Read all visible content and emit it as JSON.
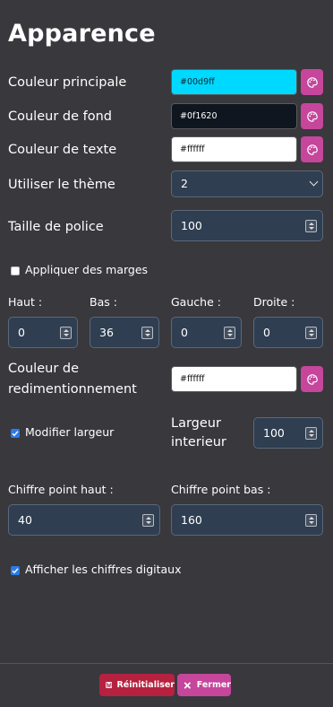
{
  "title": "Apparence",
  "colors": {
    "primary": {
      "label": "Couleur principale",
      "value": "#00d9ff"
    },
    "background": {
      "label": "Couleur de fond",
      "value": "#0f1620"
    },
    "text": {
      "label": "Couleur de texte",
      "value": "#ffffff"
    }
  },
  "theme": {
    "label": "Utiliser le thème",
    "value": "2"
  },
  "font_size": {
    "label": "Taille de police",
    "value": "100"
  },
  "margins": {
    "toggle_label": "Appliquer des marges",
    "top_label": "Haut :",
    "top_value": "0",
    "bottom_label": "Bas :",
    "bottom_value": "36",
    "left_label": "Gauche :",
    "left_value": "0",
    "right_label": "Droite :",
    "right_value": "0"
  },
  "resize_color": {
    "label_line1": "Couleur de",
    "label_line2": "redimentionnement",
    "value": "#ffffff"
  },
  "width": {
    "toggle_label": "Modifier largeur",
    "inner_label_line1": "Largeur",
    "inner_label_line2": "interieur",
    "inner_value": "100"
  },
  "digits": {
    "top_label": "Chiffre point haut :",
    "top_value": "40",
    "bottom_label": "Chiffre point bas :",
    "bottom_value": "160",
    "show_label": "Afficher les chiffres digitaux"
  },
  "footer": {
    "reset_label": "Réinitialiser",
    "close_label": "Fermer"
  },
  "accent_colors": {
    "reset": "#b5213f",
    "close": "#c5469b",
    "palette": "#c5469b",
    "checkbox": "#2c7be5"
  },
  "icons": {
    "palette": "palette-icon",
    "save": "save-icon",
    "close": "close-icon"
  }
}
